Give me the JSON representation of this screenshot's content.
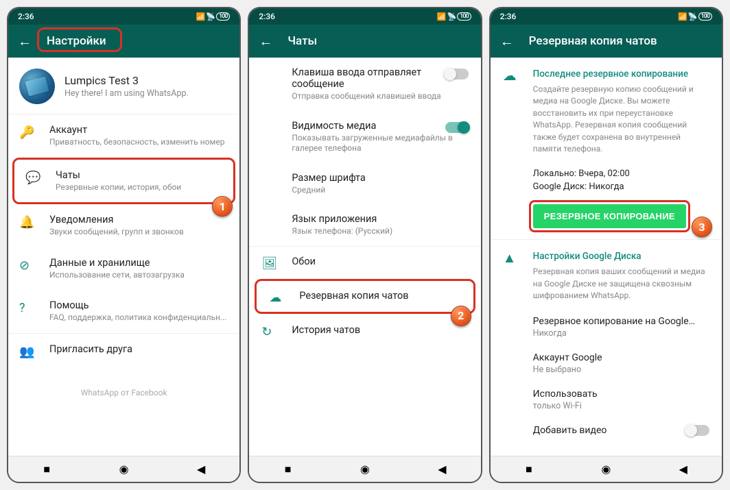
{
  "status": {
    "time": "2:36",
    "battery": "100"
  },
  "nav": {
    "square": "■",
    "circle": "◉",
    "triangle": "◀"
  },
  "screen1": {
    "title": "Настройки",
    "profile": {
      "name": "Lumpics Test 3",
      "status": "Hey there! I am using WhatsApp."
    },
    "items": [
      {
        "icon": "🔑",
        "title": "Аккаунт",
        "sub": "Приватность, безопасность, изменить номер"
      },
      {
        "icon": "💬",
        "title": "Чаты",
        "sub": "Резервные копии, история, обои"
      },
      {
        "icon": "🔔",
        "title": "Уведомления",
        "sub": "Звуки сообщений, групп и звонков"
      },
      {
        "icon": "⊘",
        "title": "Данные и хранилище",
        "sub": "Использование сети, автозагрузка"
      },
      {
        "icon": "?",
        "title": "Помощь",
        "sub": "FAQ, поддержка, политика конфиденциальн..."
      },
      {
        "icon": "👥",
        "title": "Пригласить друга",
        "sub": ""
      }
    ],
    "footer": "WhatsApp от Facebook"
  },
  "screen2": {
    "title": "Чаты",
    "rows": [
      {
        "title": "Клавиша ввода отправляет сообщение",
        "sub": "Отправка сообщений клавишей ввода",
        "toggle": "off"
      },
      {
        "title": "Видимость медиа",
        "sub": "Показывать загруженные медиафайлы в галерее телефона",
        "toggle": "on"
      },
      {
        "title": "Размер шрифта",
        "sub": "Средний"
      },
      {
        "title": "Язык приложения",
        "sub": "Язык телефона: (Русский)"
      }
    ],
    "list": [
      {
        "icon": "🖼",
        "title": "Обои"
      },
      {
        "icon": "☁",
        "title": "Резервная копия чатов"
      },
      {
        "icon": "↻",
        "title": "История чатов"
      }
    ]
  },
  "screen3": {
    "title": "Резервная копия чатов",
    "section1": {
      "head": "Последнее резервное копирование",
      "body": "Создайте резервную копию сообщений и медиа на Google Диске. Вы можете восстановить их при переустановке WhatsApp. Резервная копия сообщений также будет сохранена во внутренней памяти телефона.",
      "local": "Локально: Вчера, 02:00",
      "gdrive": "Google Диск: Никогда",
      "button": "РЕЗЕРВНОЕ КОПИРОВАНИЕ"
    },
    "section2": {
      "head": "Настройки Google Диска",
      "body": "Резервная копия ваших сообщений и медиа на Google Диске не защищена сквозным шифрованием WhatsApp.",
      "rows": [
        {
          "title": "Резервное копирование на Google…",
          "sub": "Никогда"
        },
        {
          "title": "Аккаунт Google",
          "sub": "Не выбрано"
        },
        {
          "title": "Использовать",
          "sub": "только Wi-Fi"
        },
        {
          "title": "Добавить видео",
          "sub": ""
        }
      ]
    }
  }
}
